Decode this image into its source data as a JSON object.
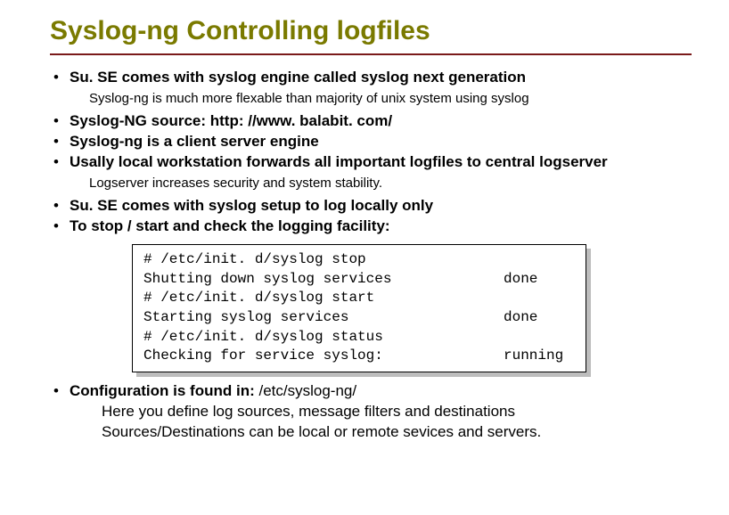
{
  "title": "Syslog-ng Controlling logfiles",
  "bullets": {
    "b1": "Su. SE comes with syslog engine called syslog next generation",
    "b1_sub": "Syslog-ng is much more flexable than majority of unix system using syslog",
    "b2": "Syslog-NG source: http: //www. balabit. com/",
    "b3": "Syslog-ng is a client server engine",
    "b4": "Usally local workstation forwards all important logfiles to central logserver",
    "b4_sub": "Logserver increases security and system stability.",
    "b5": "Su. SE comes with syslog setup to log locally only",
    "b6": "To stop / start and check the logging facility:",
    "b7_bold": "Configuration is found in: ",
    "b7_rest": "/etc/syslog-ng/",
    "b7_sub1": "Here you define log sources, message filters and destinations",
    "b7_sub2": "Sources/Destinations can be local or remote sevices and servers."
  },
  "code": {
    "l1": "# /etc/init. d/syslog stop",
    "l2": "Shutting down syslog services",
    "l2s": "done",
    "l3": "# /etc/init. d/syslog start",
    "l4": "Starting syslog services",
    "l4s": "done",
    "l5": "# /etc/init. d/syslog status",
    "l6": "Checking for service syslog:",
    "l6s": "running"
  }
}
